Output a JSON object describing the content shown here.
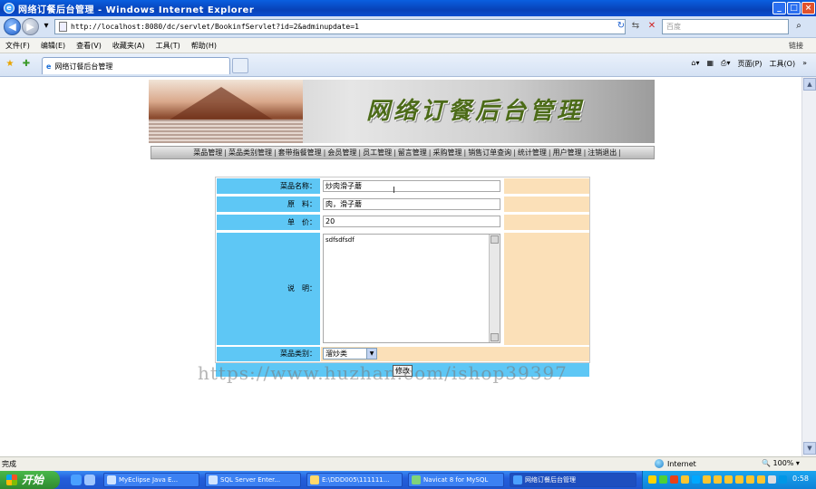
{
  "window": {
    "title": "网络订餐后台管理 - Windows Internet Explorer"
  },
  "browser": {
    "address": "http://localhost:8080/dc/servlet/BookinfServlet?id=2&adminupdate=1",
    "search_placeholder": "百度",
    "menu": [
      "文件(F)",
      "编辑(E)",
      "查看(V)",
      "收藏夹(A)",
      "工具(T)",
      "帮助(H)"
    ],
    "links_label": "链接",
    "tab_title": "网络订餐后台管理",
    "cmd_page": "页面(P)",
    "cmd_tools": "工具(O)"
  },
  "banner": {
    "title": "网络订餐后台管理"
  },
  "nav": [
    "菜品管理",
    "菜品类别管理",
    "套带指餐管理",
    "会员管理",
    "员工管理",
    "留言管理",
    "采购管理",
    "销售订单查询",
    "统计管理",
    "用户管理",
    "注销退出"
  ],
  "form": {
    "name_label": "菜品名称：",
    "name_value": "炒肉滑子蘑",
    "material_label": "原　料：",
    "material_value": "肉，滑子蘑",
    "price_label": "单　价：",
    "price_value": "20",
    "desc_label": "说　明：",
    "desc_value": "sdfsdfsdf",
    "category_label": "菜品类别：",
    "category_value": "溜炒类",
    "submit_label": "修改"
  },
  "watermark": "https://www.huzhan.com/ishop39397",
  "status": {
    "left": "完成",
    "zone": "Internet",
    "zoom": "100%"
  },
  "taskbar": {
    "start": "开始",
    "tasks": [
      "MyEclipse Java E...",
      "SQL Server Enter...",
      "E:\\DDD005\\111111...",
      "Navicat 8 for MySQL",
      "网络订餐后台管理"
    ],
    "clock": "0:58"
  }
}
